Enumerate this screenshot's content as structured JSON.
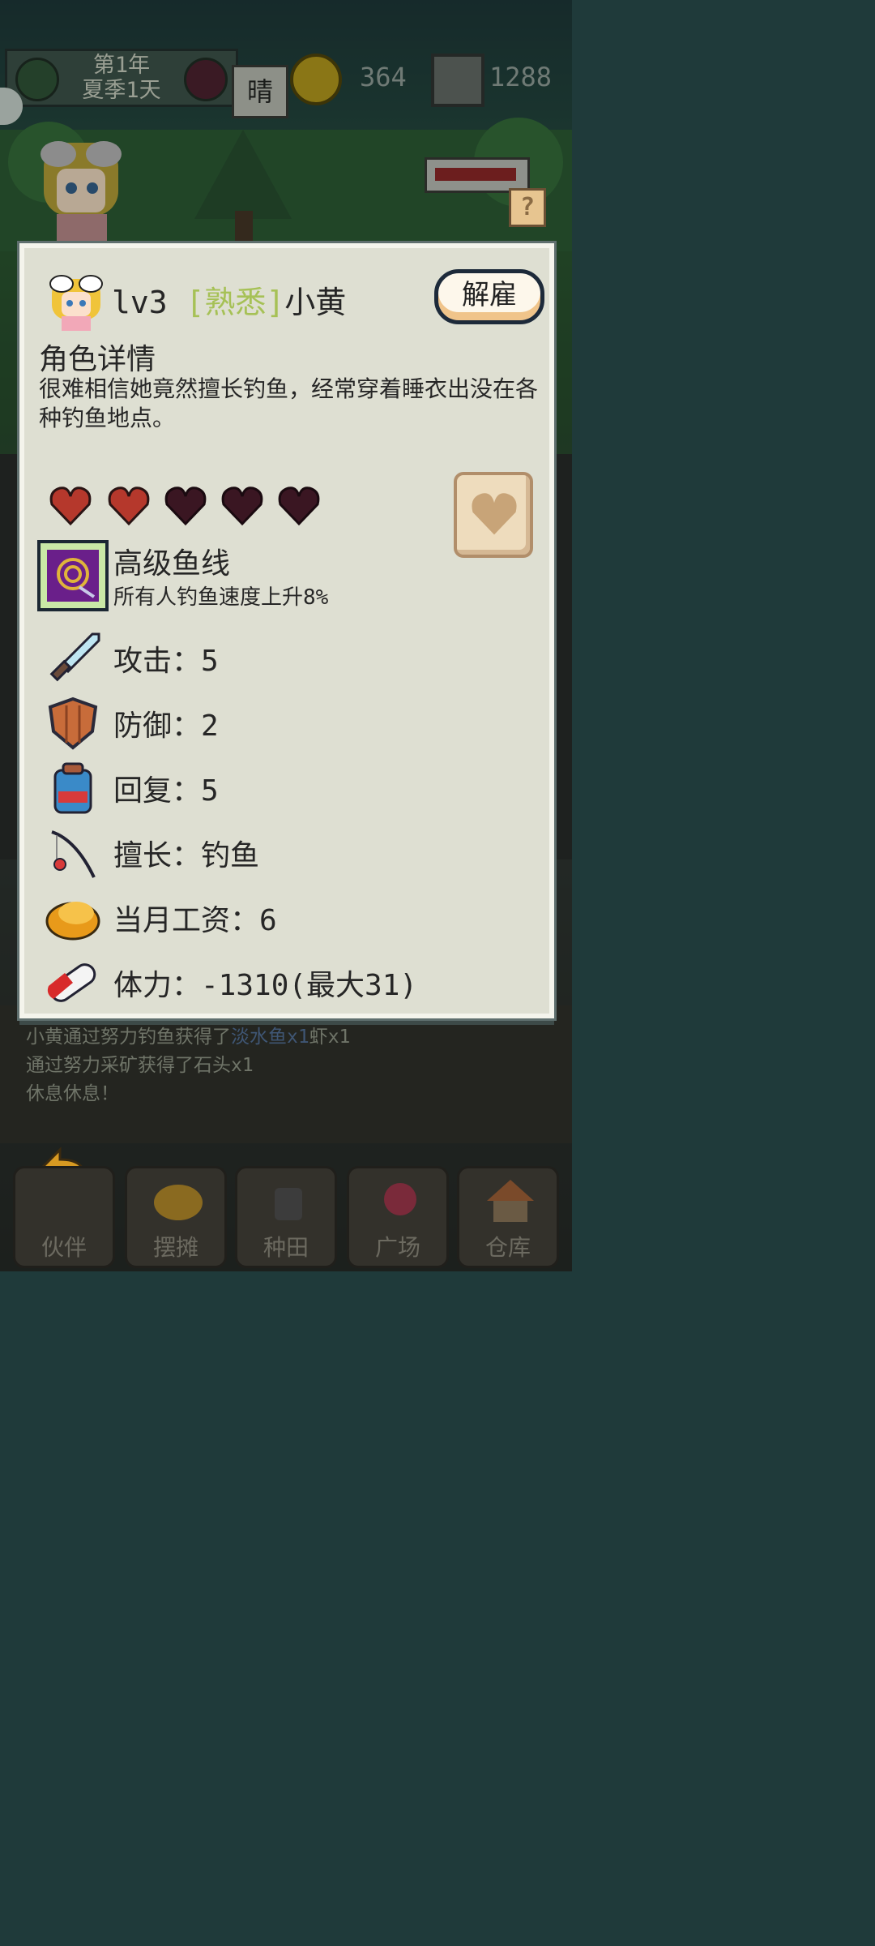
{
  "hud": {
    "date_line1": "第1年",
    "date_line2": "夏季1天",
    "weather": "晴",
    "coins": "364",
    "gems": "1288"
  },
  "character": {
    "level": "lv3",
    "relation": "[熟悉]",
    "name": "小黄",
    "fire_button": "解雇",
    "detail_title": "角色详情",
    "description": "很难相信她竟然擅长钓鱼，经常穿着睡衣出没在各种钓鱼地点。",
    "affection": {
      "filled": 2,
      "max": 5
    },
    "skill": {
      "name": "高级鱼线",
      "desc": "所有人钓鱼速度上升8%"
    },
    "stats": [
      {
        "icon": "sword-icon",
        "text": "攻击：5"
      },
      {
        "icon": "shield-icon",
        "text": "防御：2"
      },
      {
        "icon": "backpack-icon",
        "text": "回复：5"
      },
      {
        "icon": "fishing-rod-icon",
        "text": "擅长：钓鱼"
      },
      {
        "icon": "gold-coins-icon",
        "text": "当月工资：6"
      },
      {
        "icon": "pill-icon",
        "text": "体力：-1310(最大31)"
      }
    ]
  },
  "log": {
    "line1_prefix": "小黄通过努力钓鱼获得了",
    "line1_item": "淡水鱼x1",
    "line1_suffix": "虾x1",
    "line2": "通过努力采矿获得了石头x1",
    "line3": "休息休息！"
  },
  "nav": [
    {
      "label": "伙伴",
      "icon": "partner-icon"
    },
    {
      "label": "摆摊",
      "icon": "stall-icon"
    },
    {
      "label": "种田",
      "icon": "farm-icon"
    },
    {
      "label": "广场",
      "icon": "plaza-icon"
    },
    {
      "label": "仓库",
      "icon": "warehouse-icon"
    }
  ],
  "colors": {
    "panel_bg": "#dedfd2",
    "relation_tag": "#a6c156",
    "heart_filled": "#b5382c",
    "heart_empty": "#3a1622"
  }
}
